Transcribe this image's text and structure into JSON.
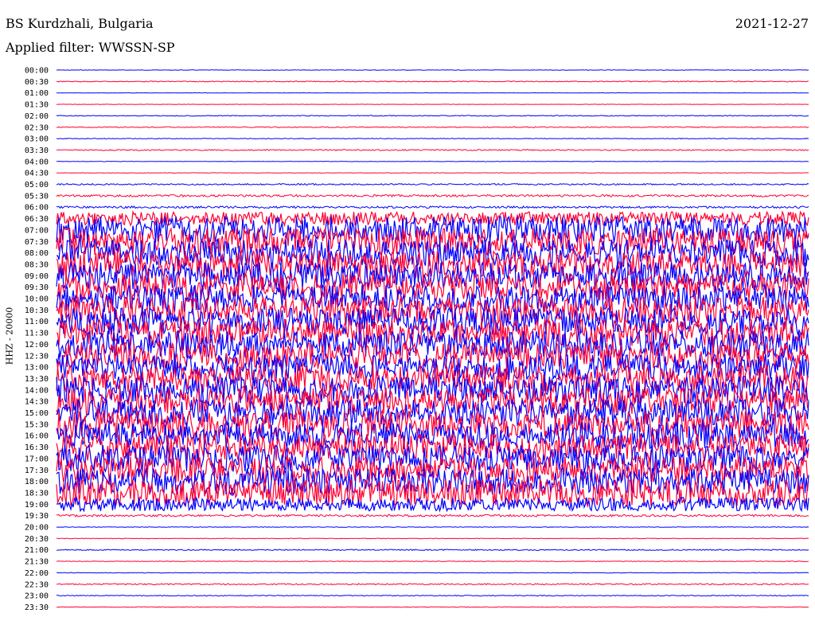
{
  "header": {
    "station": "BS Kurdzhali, Bulgaria",
    "date": "2021-12-27",
    "filter": "Applied filter: WWSSN-SP"
  },
  "channel_label": "HHZ - 20000",
  "colors": {
    "odd_trace": "#0000ff",
    "even_trace": "#ff0033",
    "text": "#000000"
  },
  "chart_data": {
    "type": "line",
    "title": "BS Kurdzhali, Bulgaria",
    "subtitle": "Applied filter: WWSSN-SP",
    "ylabel": "HHZ - 20000",
    "row_labels": [
      "00:00",
      "00:30",
      "01:00",
      "01:30",
      "02:00",
      "02:30",
      "03:00",
      "03:30",
      "04:00",
      "04:30",
      "05:00",
      "05:30",
      "06:00",
      "06:30",
      "07:00",
      "07:30",
      "08:00",
      "08:30",
      "09:00",
      "09:30",
      "10:00",
      "10:30",
      "11:00",
      "11:30",
      "12:00",
      "12:30",
      "13:00",
      "13:30",
      "14:00",
      "14:30",
      "15:00",
      "15:30",
      "16:00",
      "16:30",
      "17:00",
      "17:30",
      "18:00",
      "18:30",
      "19:00",
      "19:30",
      "20:00",
      "20:30",
      "21:00",
      "21:30",
      "22:00",
      "22:30",
      "23:00",
      "23:30"
    ],
    "relative_amplitude": [
      0.3,
      0.6,
      0.2,
      0.2,
      0.6,
      0.6,
      0.5,
      0.8,
      0.3,
      0.3,
      1,
      1.5,
      1.5,
      5,
      10,
      10,
      10,
      10,
      10,
      10,
      10,
      10,
      10,
      10,
      10,
      10,
      10,
      10,
      10,
      10,
      10,
      10,
      10,
      10,
      10,
      10,
      10,
      10,
      5,
      1.5,
      0.4,
      0.4,
      0.8,
      0.4,
      0.4,
      0.9,
      0.6,
      0.4
    ],
    "grid": false
  }
}
